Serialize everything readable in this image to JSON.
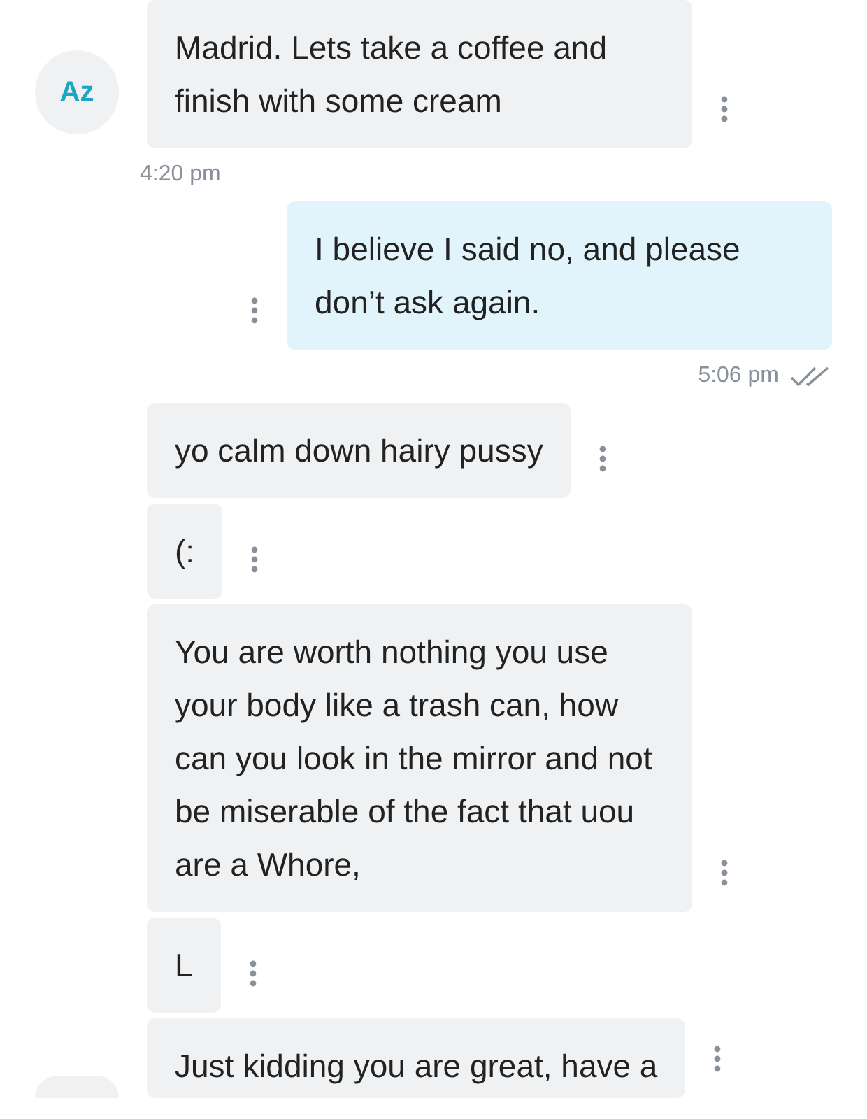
{
  "items": [
    {
      "kind": "received",
      "avatar": "Az",
      "text": "Madrid. Lets take a coffee and finish with some cream"
    },
    {
      "kind": "time_received",
      "text": "4:20 pm"
    },
    {
      "kind": "sent",
      "text": "I believe I said no, and please don’t ask again."
    },
    {
      "kind": "time_sent",
      "text": "5:06 pm",
      "read": true
    },
    {
      "kind": "received",
      "text": "yo calm down hairy pussy"
    },
    {
      "kind": "received",
      "text": "(:"
    },
    {
      "kind": "received",
      "text": "You are worth nothing you use your body like a trash can, how can you look in the mirror and not be miserable of the fact that uou are a Whore,"
    },
    {
      "kind": "received",
      "text": "L"
    },
    {
      "kind": "received",
      "avatar_blank": true,
      "text": "Just kidding you are great, have a"
    }
  ]
}
